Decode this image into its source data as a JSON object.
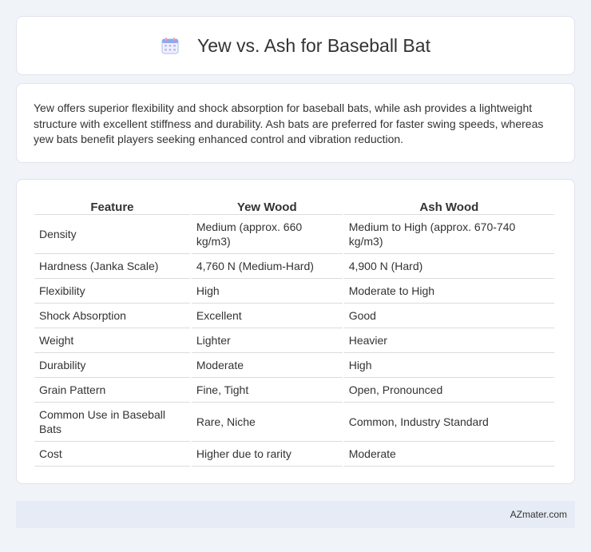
{
  "header": {
    "icon": "calendar-icon",
    "title": "Yew vs. Ash for Baseball Bat"
  },
  "summary": {
    "text": "Yew offers superior flexibility and shock absorption for baseball bats, while ash provides a lightweight structure with excellent stiffness and durability. Ash bats are preferred for faster swing speeds, whereas yew bats benefit players seeking enhanced control and vibration reduction."
  },
  "table": {
    "headers": [
      "Feature",
      "Yew Wood",
      "Ash Wood"
    ],
    "rows": [
      [
        "Density",
        "Medium (approx. 660 kg/m3)",
        "Medium to High (approx. 670-740 kg/m3)"
      ],
      [
        "Hardness (Janka Scale)",
        "4,760 N (Medium-Hard)",
        "4,900 N (Hard)"
      ],
      [
        "Flexibility",
        "High",
        "Moderate to High"
      ],
      [
        "Shock Absorption",
        "Excellent",
        "Good"
      ],
      [
        "Weight",
        "Lighter",
        "Heavier"
      ],
      [
        "Durability",
        "Moderate",
        "High"
      ],
      [
        "Grain Pattern",
        "Fine, Tight",
        "Open, Pronounced"
      ],
      [
        "Common Use in Baseball Bats",
        "Rare, Niche",
        "Common, Industry Standard"
      ],
      [
        "Cost",
        "Higher due to rarity",
        "Moderate"
      ]
    ]
  },
  "footer": {
    "site": "AZmater.com"
  },
  "colors": {
    "page_bg": "#f0f3f8",
    "card_bg": "#ffffff",
    "footer_bg": "#e6ebf5",
    "icon_accent": "#8fa8f0"
  }
}
